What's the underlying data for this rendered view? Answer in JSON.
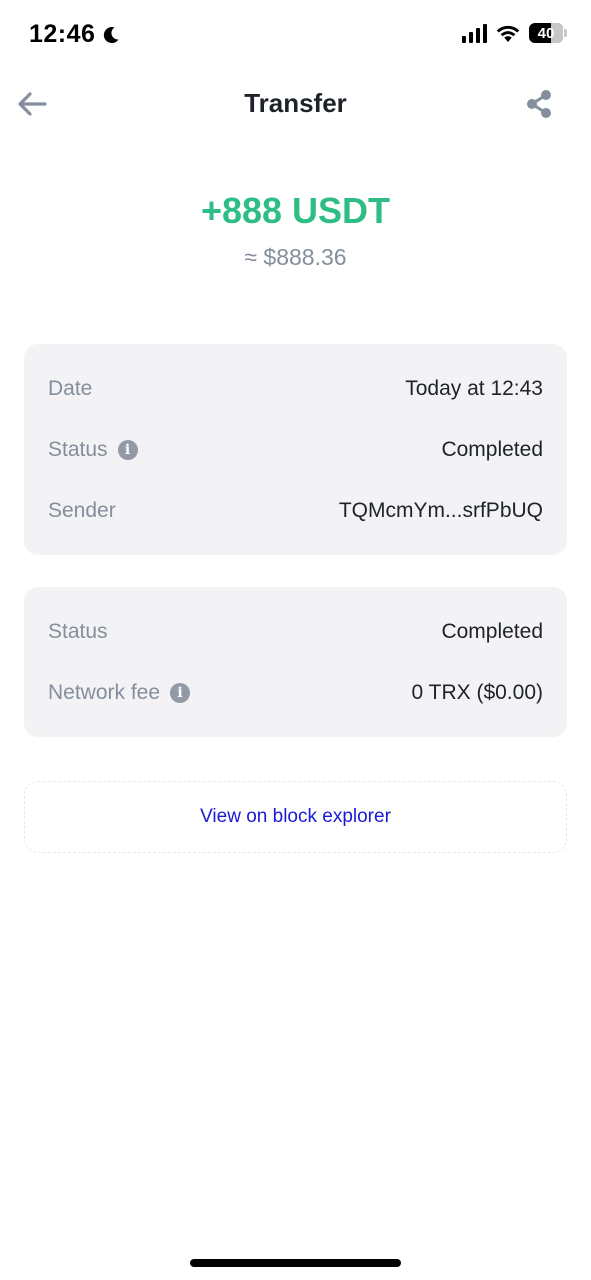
{
  "status_bar": {
    "time": "12:46",
    "battery": "40"
  },
  "header": {
    "title": "Transfer"
  },
  "transaction": {
    "amount": "+888 USDT",
    "fiat_equivalent": "≈ $888.36",
    "amount_color": "#2ebd85"
  },
  "details_card": {
    "rows": [
      {
        "label": "Date",
        "value": "Today at 12:43"
      },
      {
        "label": "Status",
        "value": "Completed"
      },
      {
        "label": "Sender",
        "value": "TQMcmYm...srfPbUQ"
      }
    ]
  },
  "network_card": {
    "rows": [
      {
        "label": "Status",
        "value": "Completed"
      },
      {
        "label": "Network fee",
        "value": "0 TRX ($0.00)"
      }
    ]
  },
  "explorer": {
    "label": "View on block explorer",
    "link_color": "#1a1ad6"
  },
  "icons": {
    "back": "arrow-left-icon",
    "share": "share-icon",
    "info": "info-icon",
    "moon": "moon-icon"
  }
}
